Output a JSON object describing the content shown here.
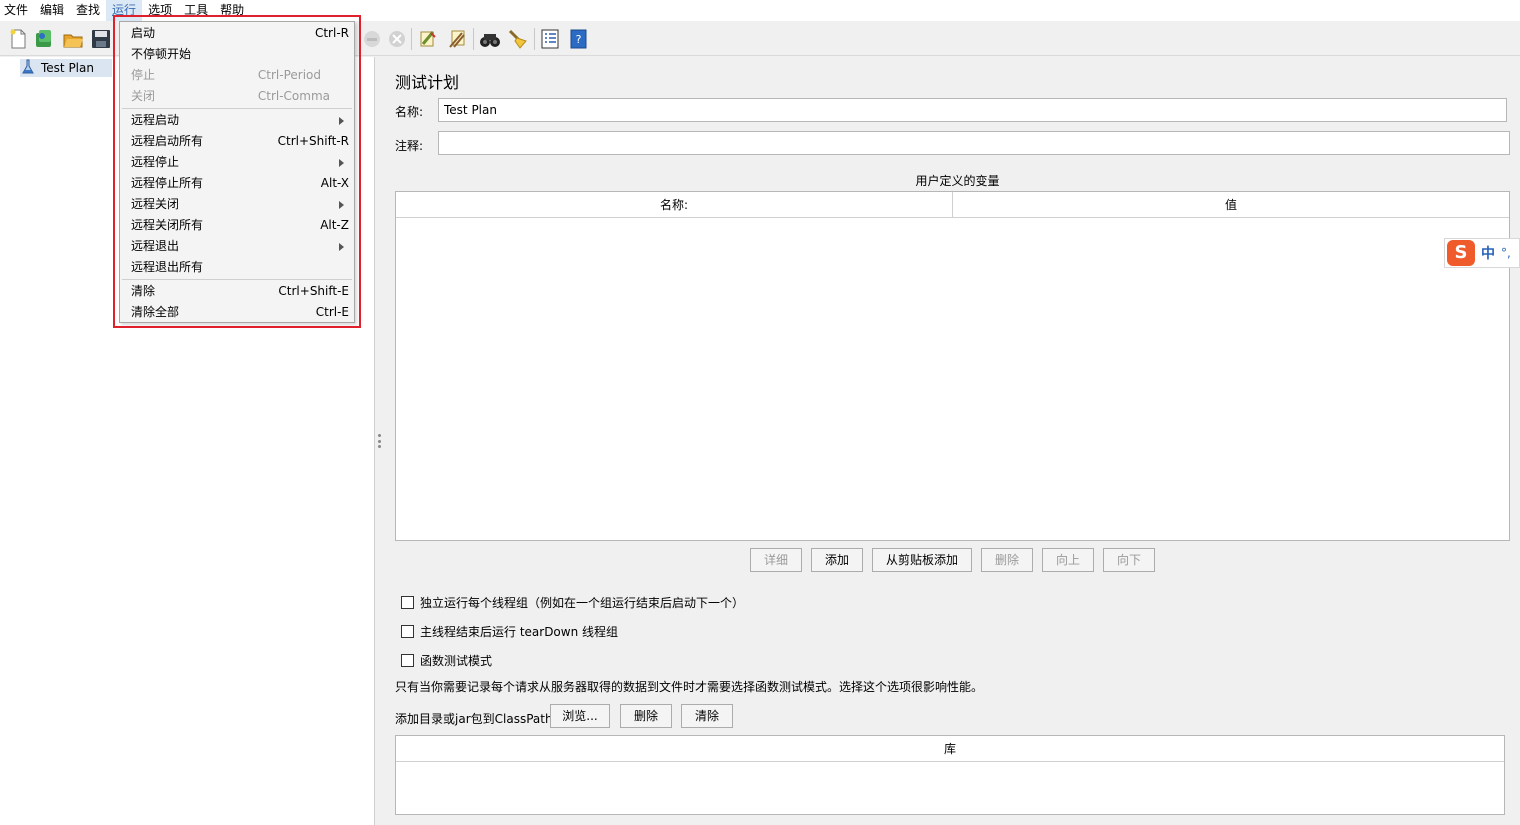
{
  "menubar": {
    "items": [
      "文件",
      "编辑",
      "查找",
      "运行",
      "选项",
      "工具",
      "帮助"
    ],
    "active_index": 3
  },
  "toolbar": {
    "icons": [
      "new-icon",
      "templates-icon",
      "open-icon",
      "save-icon",
      "cut-icon",
      "copy-icon",
      "paste-icon",
      "expand-icon",
      "collapse-icon",
      "toggle-icon",
      "start-icon",
      "start-no-pause-icon",
      "stop-icon",
      "shutdown-icon",
      "clear-icon",
      "clear-all-icon",
      "search-icon",
      "reset-search-icon",
      "function-helper-icon",
      "help-icon"
    ]
  },
  "tree": {
    "root_label": "Test Plan"
  },
  "run_menu": {
    "items": [
      {
        "label": "启动",
        "shortcut": "Ctrl-R",
        "disabled": false,
        "submenu": false
      },
      {
        "label": "不停顿开始",
        "shortcut": "",
        "disabled": false,
        "submenu": false
      },
      {
        "label": "停止",
        "shortcut": "Ctrl-Period",
        "disabled": true,
        "submenu": false
      },
      {
        "label": "关闭",
        "shortcut": "Ctrl-Comma",
        "disabled": true,
        "submenu": false
      },
      {
        "label": "远程启动",
        "shortcut": "",
        "disabled": false,
        "submenu": true
      },
      {
        "label": "远程启动所有",
        "shortcut": "Ctrl+Shift-R",
        "disabled": false,
        "submenu": false
      },
      {
        "label": "远程停止",
        "shortcut": "",
        "disabled": false,
        "submenu": true
      },
      {
        "label": "远程停止所有",
        "shortcut": "Alt-X",
        "disabled": false,
        "submenu": false
      },
      {
        "label": "远程关闭",
        "shortcut": "",
        "disabled": false,
        "submenu": true
      },
      {
        "label": "远程关闭所有",
        "shortcut": "Alt-Z",
        "disabled": false,
        "submenu": false
      },
      {
        "label": "远程退出",
        "shortcut": "",
        "disabled": false,
        "submenu": true
      },
      {
        "label": "远程退出所有",
        "shortcut": "",
        "disabled": false,
        "submenu": false
      },
      {
        "label": "清除",
        "shortcut": "Ctrl+Shift-E",
        "disabled": false,
        "submenu": false
      },
      {
        "label": "清除全部",
        "shortcut": "Ctrl-E",
        "disabled": false,
        "submenu": false
      }
    ]
  },
  "panel": {
    "title": "测试计划",
    "name_label": "名称:",
    "name_value": "Test Plan",
    "comment_label": "注释:",
    "comment_value": "",
    "variables_title": "用户定义的变量",
    "variables_columns": [
      "名称:",
      "值"
    ],
    "buttons": {
      "detail": "详细",
      "add": "添加",
      "add_from_clipboard": "从剪贴板添加",
      "delete": "删除",
      "up": "向上",
      "down": "向下"
    },
    "checkboxes": {
      "serialize": "独立运行每个线程组（例如在一个组运行结束后启动下一个）",
      "teardown": "主线程结束后运行 tearDown 线程组",
      "functional": "函数测试模式"
    },
    "functional_hint": "只有当你需要记录每个请求从服务器取得的数据到文件时才需要选择函数测试模式。选择这个选项很影响性能。",
    "classpath_label": "添加目录或jar包到ClassPath",
    "classpath_buttons": {
      "browse": "浏览...",
      "delete": "删除",
      "clear": "清除"
    },
    "library_column": "库"
  },
  "ime": {
    "logo": "S",
    "mode": "中",
    "punct": "°,"
  }
}
